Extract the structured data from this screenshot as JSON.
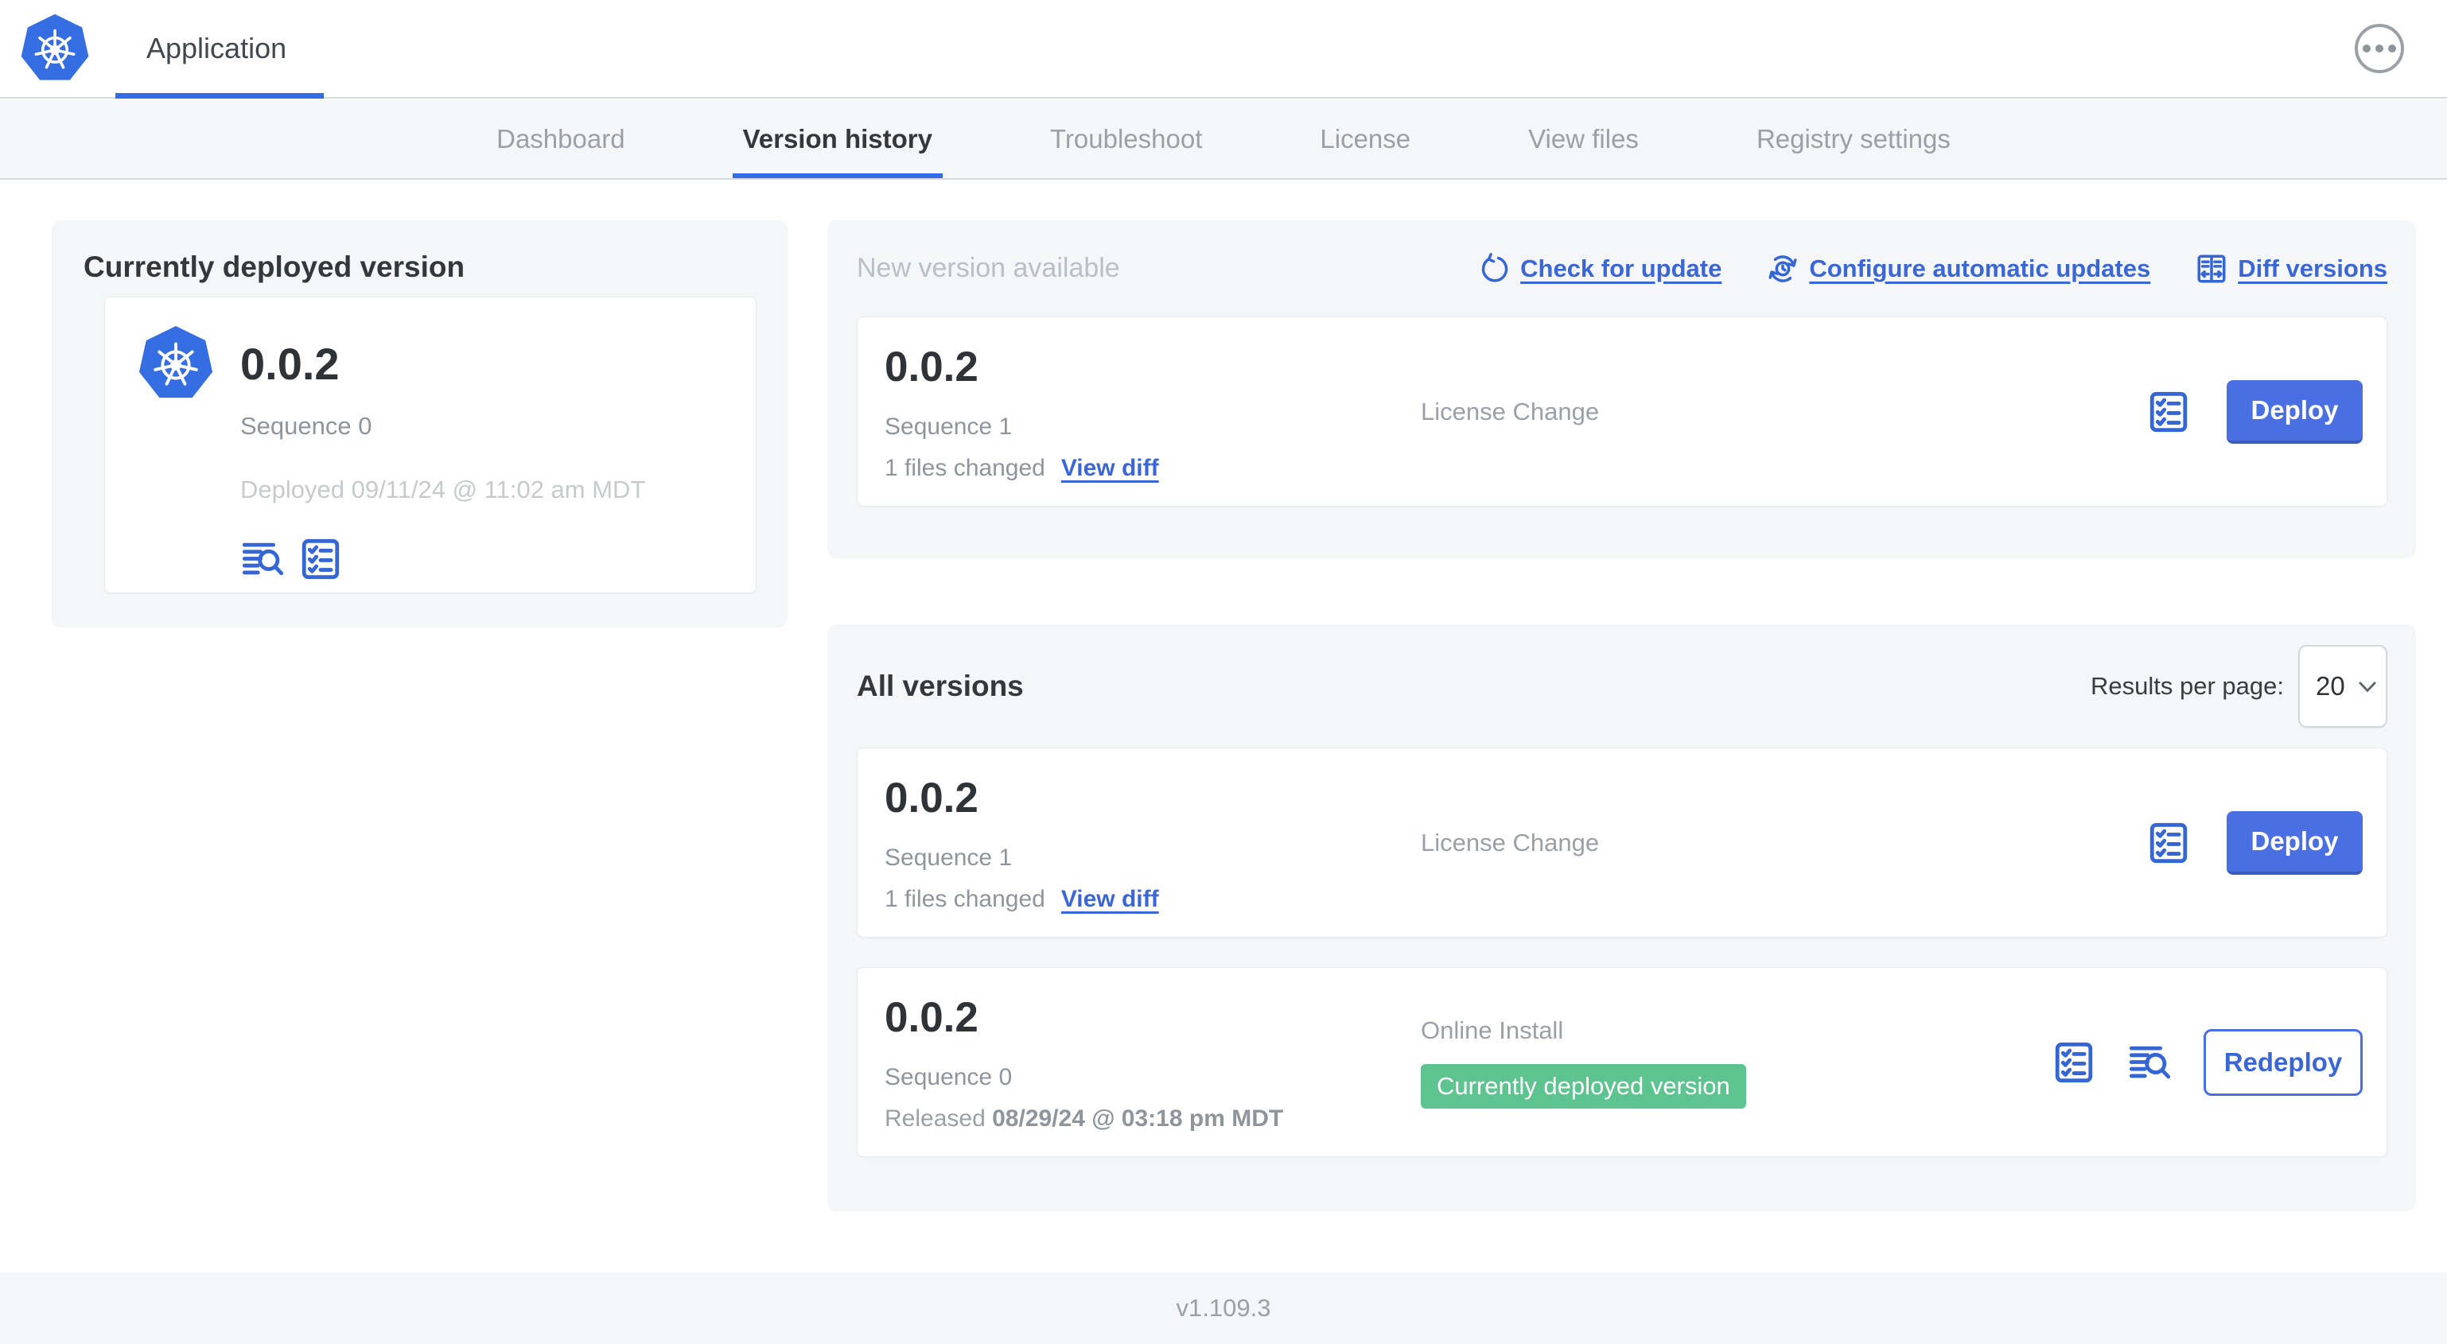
{
  "colors": {
    "accent_blue": "#326de6",
    "link_blue": "#3b66d6",
    "button_blue": "#4a6fe3",
    "badge_green": "#5ec48f",
    "panel_gray": "#f4f6f8"
  },
  "header": {
    "app_title": "Application"
  },
  "nav": {
    "tabs": [
      "Dashboard",
      "Version history",
      "Troubleshoot",
      "License",
      "View files",
      "Registry settings"
    ],
    "active_tab": "Version history"
  },
  "current_version": {
    "title": "Currently deployed version",
    "version": "0.0.2",
    "sequence": "Sequence 0",
    "deployed": "Deployed 09/11/24 @ 11:02 am MDT"
  },
  "new_version": {
    "heading": "New version available",
    "actions": {
      "check_for_update": "Check for update",
      "configure_automatic_updates": "Configure automatic updates",
      "diff_versions": "Diff versions"
    },
    "card": {
      "version": "0.0.2",
      "sequence": "Sequence 1",
      "files_changed": "1 files changed",
      "view_diff": "View diff",
      "source": "License Change",
      "deploy_label": "Deploy"
    }
  },
  "all_versions": {
    "title": "All versions",
    "results_per_page_label": "Results per page:",
    "results_per_page_value": "20",
    "rows": [
      {
        "version": "0.0.2",
        "sequence": "Sequence 1",
        "files_changed": "1 files changed",
        "view_diff": "View diff",
        "source": "License Change",
        "action_label": "Deploy"
      },
      {
        "version": "0.0.2",
        "sequence": "Sequence 0",
        "released_label": "Released",
        "released_date": "08/29/24 @ 03:18 pm MDT",
        "source": "Online Install",
        "badge": "Currently deployed version",
        "action_label": "Redeploy"
      }
    ]
  },
  "footer": {
    "app_manager_version": "v1.109.3"
  }
}
